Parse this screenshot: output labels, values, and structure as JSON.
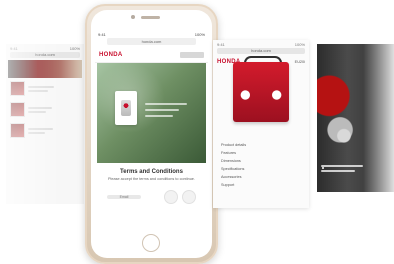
{
  "brand": {
    "name": "HONDA",
    "accent_color": "#c8102e"
  },
  "phone": {
    "url_text": "honda.com",
    "status_left": "9:41",
    "status_right": "100%",
    "title": "Terms and Conditions",
    "body": "Please accept the terms and conditions to continue.",
    "field_label": "Email"
  },
  "left_panel": {
    "url_text": "honda.com",
    "items": [
      "Item",
      "Item",
      "Item"
    ]
  },
  "right_panel": {
    "url_text": "honda.com",
    "label": "EU20i",
    "specs": [
      "Product details",
      "Features",
      "Dimensions",
      "Specifications",
      "Accessories",
      "Support"
    ]
  },
  "icons": {
    "home_button": "home-button-icon",
    "speaker": "speaker-icon",
    "camera": "camera-icon"
  }
}
